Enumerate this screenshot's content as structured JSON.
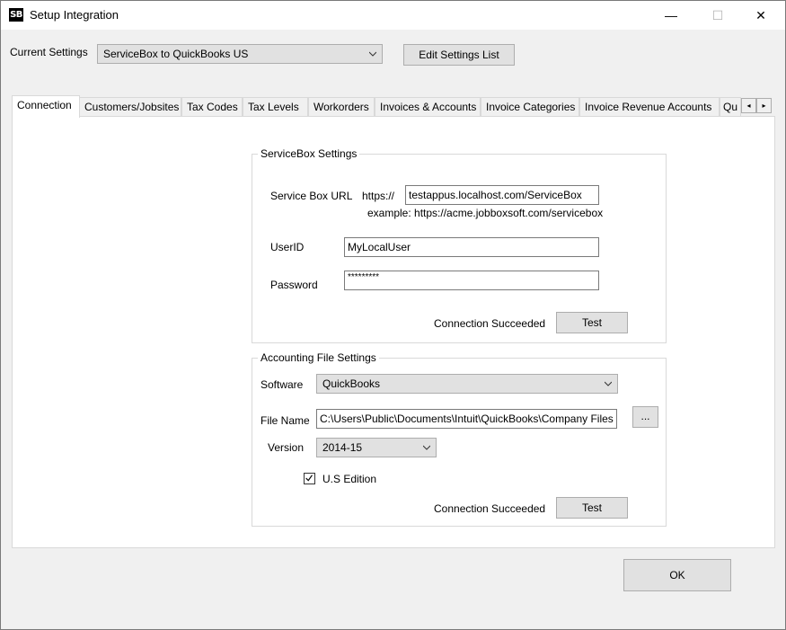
{
  "window": {
    "title": "Setup Integration",
    "icon_text": "SB",
    "controls": {
      "minimize": "—",
      "maximize": "☐",
      "close": "✕"
    }
  },
  "header": {
    "current_settings_label": "Current Settings",
    "current_settings_value": "ServiceBox to QuickBooks US",
    "edit_settings_button": "Edit Settings List"
  },
  "tabs": [
    {
      "label": "Connection",
      "active": true
    },
    {
      "label": "Customers/Jobsites"
    },
    {
      "label": "Tax Codes"
    },
    {
      "label": "Tax Levels"
    },
    {
      "label": "Workorders"
    },
    {
      "label": "Invoices & Accounts"
    },
    {
      "label": "Invoice Categories"
    },
    {
      "label": "Invoice Revenue Accounts"
    },
    {
      "label": "Qu"
    }
  ],
  "tab_scroll": {
    "left": "◂",
    "right": "▸"
  },
  "servicebox": {
    "group_title": "ServiceBox Settings",
    "url_label": "Service Box URL",
    "url_prefix": "https://",
    "url_value": "testappus.localhost.com/ServiceBox",
    "url_example": "example: https://acme.jobboxsoft.com/servicebox",
    "userid_label": "UserID",
    "userid_value": "MyLocalUser",
    "password_label": "Password",
    "password_value": "*********",
    "status": "Connection Succeeded",
    "test_button": "Test"
  },
  "accounting": {
    "group_title": "Accounting File Settings",
    "software_label": "Software",
    "software_value": "QuickBooks",
    "filename_label": "File Name",
    "filename_value": "C:\\Users\\Public\\Documents\\Intuit\\QuickBooks\\Company Files",
    "browse_button": "...",
    "version_label": "Version",
    "version_value": "2014-15",
    "us_edition_label": "U.S Edition",
    "us_edition_checked": true,
    "status": "Connection Succeeded",
    "test_button": "Test"
  },
  "footer": {
    "ok_button": "OK"
  }
}
